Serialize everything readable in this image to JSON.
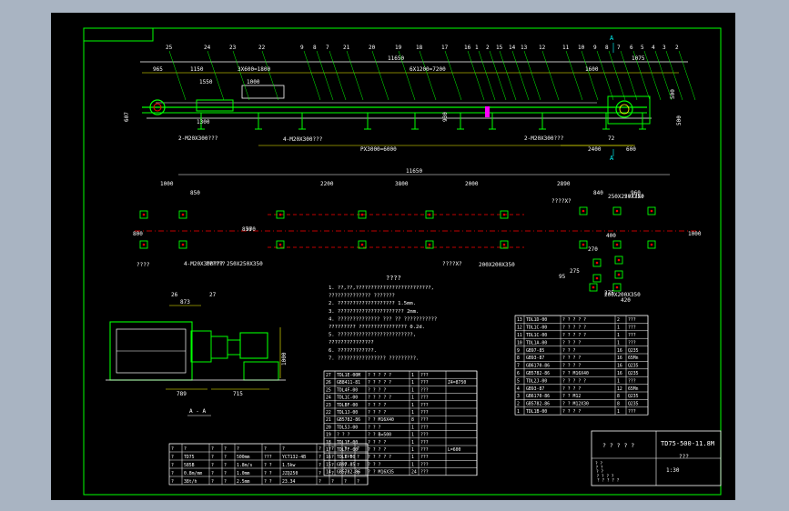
{
  "colors": {
    "background": "#a9b4c2",
    "canvas": "#000000",
    "frame": "#00ff00",
    "linework": "#ffffff",
    "dims": "#ffff00",
    "accent": "#ff0000",
    "machine": "#00ff00",
    "idler": "#ff00ff"
  },
  "view_top": {
    "balloons": [
      "25",
      "24",
      "23",
      "22",
      "9",
      "8",
      "7",
      "21",
      "20",
      "19",
      "18",
      "17",
      "16",
      "1",
      "2",
      "15",
      "14",
      "13",
      "12",
      "11",
      "10",
      "9",
      "8",
      "7",
      "6",
      "5",
      "4",
      "3",
      "2"
    ],
    "dims": {
      "d965": "965",
      "d1150": "1150",
      "d3x600": "3X600=1800",
      "d1550": "1550",
      "d1000": "1000",
      "d11650": "11650",
      "d6x1200": "6X1200=7200",
      "d1600": "1600",
      "d1075": "1075",
      "d500": "500",
      "d1300": "1300",
      "d607": "607",
      "d930": "930",
      "dpx": "PX3000=6000",
      "d2400": "2400",
      "d600": "600",
      "d72": "72",
      "d500r": "500"
    },
    "callouts": [
      "2-M20X300???",
      "4-M20X300???",
      "2-M20X300???"
    ],
    "section_mark": "A"
  },
  "view_plan": {
    "dims": [
      "11650",
      "1000",
      "850",
      "2200",
      "3800",
      "2000",
      "2890",
      "840",
      "960",
      "570",
      "800",
      "870",
      "1000",
      "400",
      "270",
      "95",
      "275",
      "275",
      "420"
    ],
    "callouts": [
      "4-M20X300??? 250X250X350",
      "????",
      "??????",
      "????X?",
      "200X200X350",
      "????X?",
      "250X250X350",
      "????X?",
      "200X200X350"
    ]
  },
  "notes": {
    "title": "????",
    "lines": [
      "1. ??,??,?????????????????????????,",
      "   ??????????????               ???????",
      "2. ???????????????????          1.5mm.",
      "3. ??????????????????????       2mm.",
      "4. ?????????????? ??? ?? ???????????",
      "   ?????????    ????????????????  0.2d.",
      "5. ?????????????????????????,",
      "   ???????????????",
      "6. ????????????.",
      "7. ???????????????? ?????????."
    ]
  },
  "drive_view": {
    "balloons": [
      "26",
      "27"
    ],
    "dims": [
      "873",
      "789",
      "715",
      "1000"
    ],
    "section_label": "A - A"
  },
  "bom_left": {
    "rows": [
      [
        "27",
        "TDL1E-00M",
        "? ? ? ? ?",
        "1",
        "???",
        "",
        ""
      ],
      [
        "26",
        "GB8411-81",
        "? ? ? ? ?",
        "1",
        "???",
        "Z4=8750",
        ""
      ],
      [
        "25",
        "TDL4F-00",
        "? ? ? ?",
        "1",
        "???",
        "",
        ""
      ],
      [
        "24",
        "TDL1C-00",
        "? ? ? ? ?",
        "1",
        "???",
        "",
        ""
      ],
      [
        "23",
        "TDLBF-00",
        "? ? ? ?",
        "1",
        "???",
        "",
        ""
      ],
      [
        "22",
        "TDL1J-00",
        "? ? ? ?",
        "1",
        "???",
        "",
        ""
      ],
      [
        "21",
        "GB5782-86",
        "? ? M16X40",
        "8",
        "???",
        "",
        ""
      ],
      [
        "20",
        "TDL5J-00",
        "? ? ?",
        "1",
        "???",
        "",
        ""
      ],
      [
        "19",
        "? ? ?",
        "? ? B=500",
        "1",
        "???",
        "",
        ""
      ],
      [
        "18",
        "TDL1F-00",
        "? ? ? ?",
        "1",
        "???",
        "",
        ""
      ],
      [
        "17",
        "TDL7F-00",
        "? ? ? ?",
        "1",
        "???",
        "L=600",
        ""
      ],
      [
        "16",
        "TDL6-00",
        "? ? ? ? ?",
        "1",
        "???",
        "",
        ""
      ],
      [
        "15",
        "GB97-85",
        "? ? ?",
        "1",
        "???",
        "",
        ""
      ],
      [
        "14",
        "GB5782-86",
        "? ? M16X35",
        "24",
        "???",
        "",
        ""
      ]
    ],
    "extra": [
      "L=325",
      "Q235"
    ]
  },
  "bom_right": {
    "rows": [
      [
        "13",
        "TDL1D-00",
        "? ? ? ? ?",
        "2",
        "???"
      ],
      [
        "12",
        "TDL1C-00",
        "? ? ? ? ?",
        "1",
        "???"
      ],
      [
        "11",
        "TDL1C-00",
        "? ? ? ? ?",
        "1",
        "???"
      ],
      [
        "10",
        "TDL1A-00",
        "? ? ? ?",
        "1",
        "???"
      ],
      [
        "9",
        "GB97-85",
        "? ? ?",
        "16",
        "Q235"
      ],
      [
        "8",
        "GB93-87",
        "? ? ? ?",
        "16",
        "65Mn"
      ],
      [
        "7",
        "GB6170-86",
        "? ? ? ?",
        "16",
        "Q235"
      ],
      [
        "6",
        "GB5782-86",
        "? ? M16X40",
        "16",
        "Q235"
      ],
      [
        "5",
        "TDL2J-00",
        "? ? ? ? ?",
        "1",
        "???"
      ],
      [
        "4",
        "GB93-87",
        "? ? ? ?",
        "12",
        "65Mn"
      ],
      [
        "3",
        "GB6170-86",
        "? ? M12",
        "8",
        "Q235"
      ],
      [
        "2",
        "GB5782-86",
        "? ? M12X30",
        "8",
        "Q235"
      ],
      [
        "1",
        "TDL1B-00",
        "? ? ? ?",
        "1",
        "???"
      ]
    ],
    "header": [
      "?",
      "?",
      "?",
      "?",
      "?",
      "?",
      "?",
      "?",
      "?"
    ]
  },
  "spec_table": {
    "rows": [
      [
        "?",
        "?",
        "?",
        "?",
        "?",
        "?",
        "?",
        "?",
        "?",
        "?",
        "?"
      ],
      [
        "?",
        "TD75",
        "?",
        "?",
        "500mm",
        "???",
        "YCT132-4B",
        "?",
        "?",
        "???",
        "?"
      ],
      [
        "?",
        "585B",
        "?",
        "?",
        "1.8m/s",
        "? ?",
        "1.5kw",
        "?",
        "?",
        "?",
        "?"
      ],
      [
        "?",
        "0.8m/mm",
        "?",
        "?",
        "1.0mm",
        "? ?",
        "JZQ250",
        "?",
        "?",
        "?",
        "?"
      ],
      [
        "?",
        "38t/h",
        "?",
        "?",
        "2.5mm",
        "? ?",
        "23.34",
        "?",
        "?",
        "?",
        "?"
      ]
    ]
  },
  "title_block": {
    "drawing_no": "TD75-500-11.8M",
    "name": "? ? ? ? ?",
    "subname": "???",
    "scale": "1:30",
    "sheet_labels": [
      "? ?",
      "? ?",
      "? ?",
      "? ? ? ?",
      "? ? ? ? ?"
    ]
  }
}
